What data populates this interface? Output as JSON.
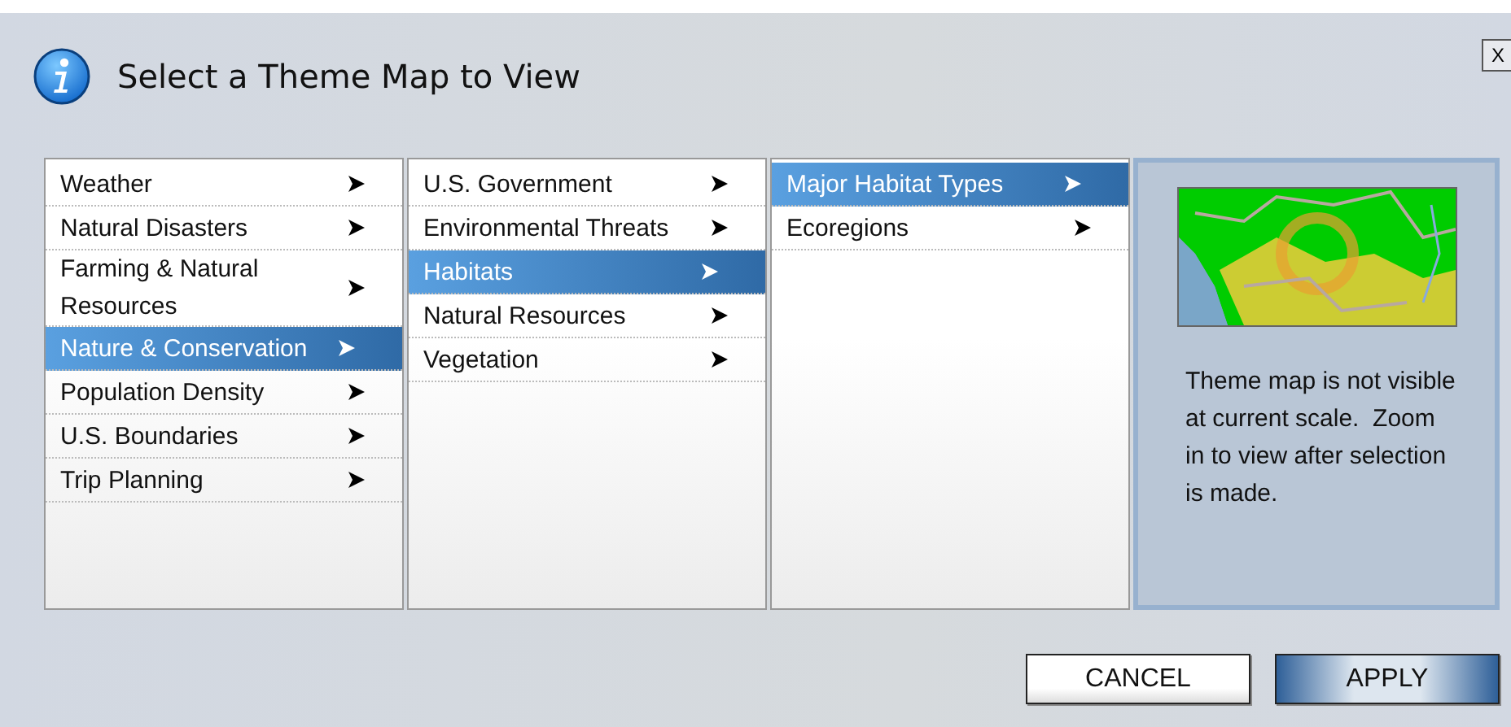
{
  "dialog": {
    "title": "Select a Theme Map to View",
    "close_label": "X"
  },
  "columns": [
    {
      "items": [
        {
          "label": "Weather",
          "selected": false
        },
        {
          "label": "Natural Disasters",
          "selected": false
        },
        {
          "label": "Farming & Natural Resources",
          "selected": false
        },
        {
          "label": "Nature & Conservation",
          "selected": true
        },
        {
          "label": "Population Density",
          "selected": false
        },
        {
          "label": "U.S. Boundaries",
          "selected": false
        },
        {
          "label": "Trip Planning",
          "selected": false
        }
      ]
    },
    {
      "items": [
        {
          "label": "U.S. Government",
          "selected": false
        },
        {
          "label": "Environmental Threats",
          "selected": false
        },
        {
          "label": "Habitats",
          "selected": true
        },
        {
          "label": "Natural Resources",
          "selected": false
        },
        {
          "label": "Vegetation",
          "selected": false
        }
      ]
    },
    {
      "items": [
        {
          "label": "Major Habitat Types",
          "selected": true
        },
        {
          "label": "Ecoregions",
          "selected": false
        }
      ]
    }
  ],
  "preview": {
    "message": "Theme map is not visible at current scale.  Zoom in to view after selection is made."
  },
  "buttons": [
    {
      "label": "CANCEL",
      "kind": "secondary"
    },
    {
      "label": "APPLY",
      "kind": "primary"
    }
  ]
}
